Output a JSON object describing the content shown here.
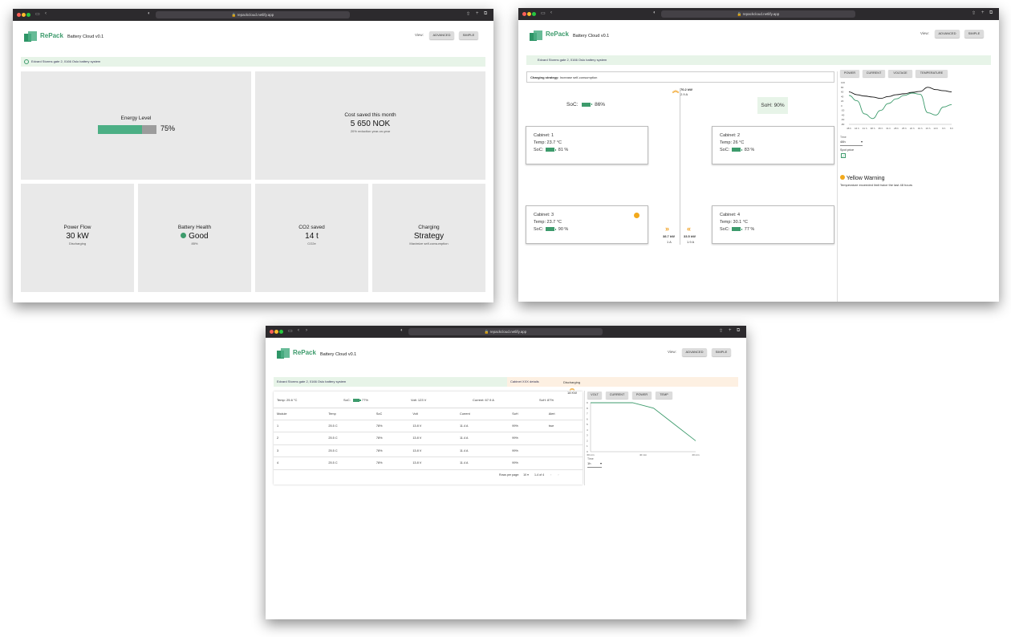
{
  "browser": {
    "url": "repackcloud.netlify.app"
  },
  "app": {
    "brand": "RePack",
    "title": "Battery Cloud v0.1",
    "view_label": "View:",
    "advanced_btn": "ADVANCED",
    "simple_btn": "SIMPLE"
  },
  "simple_view": {
    "banner": "Edvard Storms gate 2, 0166 Oslo battery system",
    "energy": {
      "title": "Energy Level",
      "value": "75%",
      "level": 0.75
    },
    "cost": {
      "title": "Cost saved this month",
      "value": "5 650 NOK",
      "sub": "20% reduction year-on-year"
    },
    "power": {
      "title": "Power Flow",
      "value": "30 kW",
      "sub": "Discharging"
    },
    "health": {
      "title": "Battery Health",
      "value": "Good",
      "sub": "85%"
    },
    "co2": {
      "title": "CO2 saved",
      "value": "14 t",
      "sub": "CO2e"
    },
    "charging": {
      "title": "Charging",
      "value": "Strategy",
      "sub": "Maximize self-consumption"
    }
  },
  "advanced_view": {
    "banner": "Edvard Storms gate 2, 0166 Oslo battery system",
    "strategy_label": "Charging strategy:",
    "strategy_value": "Increase self-consumption",
    "soc_label": "SoC:",
    "soc_value": "86%",
    "soh": "SoH: 90%",
    "top_flow": {
      "power": "70.2 kW",
      "current": "2.9 A"
    },
    "flow_left": {
      "power": "38.7 kW",
      "current": "1 A"
    },
    "flow_right": {
      "power": "33.5 kW",
      "current": "1.9 A"
    },
    "cabinets": [
      {
        "name": "Cabinet: 1",
        "temp": "Temp: 23.7 °C",
        "soc": "81 %"
      },
      {
        "name": "Cabinet: 2",
        "temp": "Temp: 26 °C",
        "soc": "83 %"
      },
      {
        "name": "Cabinet: 3",
        "temp": "Temp: 23.7 °C",
        "soc": "90 %"
      },
      {
        "name": "Cabinet: 4",
        "temp": "Temp: 30.1 °C",
        "soc": "77 %"
      }
    ],
    "tabs": [
      "POWER",
      "CURRENT",
      "VOLTAGE",
      "TEMPERATURE"
    ],
    "time_label": "Time",
    "time_value": "48h",
    "spot_label": "Spot price",
    "warning_title": "Yellow Warning",
    "warning_text": "Temperature exceeded limit twice the last 48 hours",
    "chart_data": {
      "type": "line",
      "x": [
        "48 h",
        "44 h",
        "41 h",
        "38 h",
        "35 h",
        "31 h",
        "28 h",
        "25 h",
        "22 h",
        "19 h",
        "16 h",
        "13 h",
        "9 h",
        "6 h"
      ],
      "series": [
        {
          "values": [
            60,
            48,
            42,
            38,
            32,
            40,
            48,
            52,
            58,
            62,
            80,
            70,
            65,
            60
          ],
          "color": "#111111"
        },
        {
          "values": [
            45,
            22,
            -35,
            -55,
            -20,
            10,
            30,
            45,
            55,
            50,
            -30,
            -40,
            -5,
            5
          ],
          "color": "#3d9b6c"
        }
      ],
      "ylim": [
        -80,
        100
      ]
    }
  },
  "cabinet_view": {
    "banner_left": "Edvard Storms gate 2, 0166 Oslo battery system",
    "banner_right": "Cabinet XXX details",
    "temp": "Temp: 25.6 °C",
    "soc_label": "SoC:",
    "soc_value": "77%",
    "volt": "Volt: 123 V",
    "current": "Current: 67.9 A",
    "soh": "SoH: 87%",
    "discharge_label": "Discharging",
    "discharge_value": "18 KW",
    "table": {
      "headers": [
        "Module",
        "Temp",
        "SoC",
        "Volt",
        "Current",
        "SoH",
        "Alert"
      ],
      "rows": [
        [
          "1",
          "25.5 C",
          "78%",
          "13.8 V",
          "11.4 A",
          "99%",
          "true"
        ],
        [
          "2",
          "25.5 C",
          "78%",
          "13.8 V",
          "11.4 A",
          "99%",
          ""
        ],
        [
          "3",
          "25.5 C",
          "78%",
          "13.8 V",
          "11.4 A",
          "99%",
          ""
        ],
        [
          "4",
          "25.5 C",
          "78%",
          "13.8 V",
          "11.4 A",
          "99%",
          ""
        ]
      ]
    },
    "pagination": {
      "rows_label": "Rows per page:",
      "rows_value": "10",
      "range": "1-4 of 4"
    },
    "tabs": [
      "VOLT",
      "CURRENT",
      "POWER",
      "TEMP"
    ],
    "time_label": "Time",
    "time_value": "1h",
    "chart_data": {
      "type": "line",
      "x": [
        "60 min",
        "40 min",
        "20 min"
      ],
      "series": [
        {
          "values": [
            9,
            9,
            9,
            8,
            5,
            2
          ],
          "color": "#3d9b6c"
        }
      ],
      "ylim": [
        0,
        9
      ]
    }
  }
}
